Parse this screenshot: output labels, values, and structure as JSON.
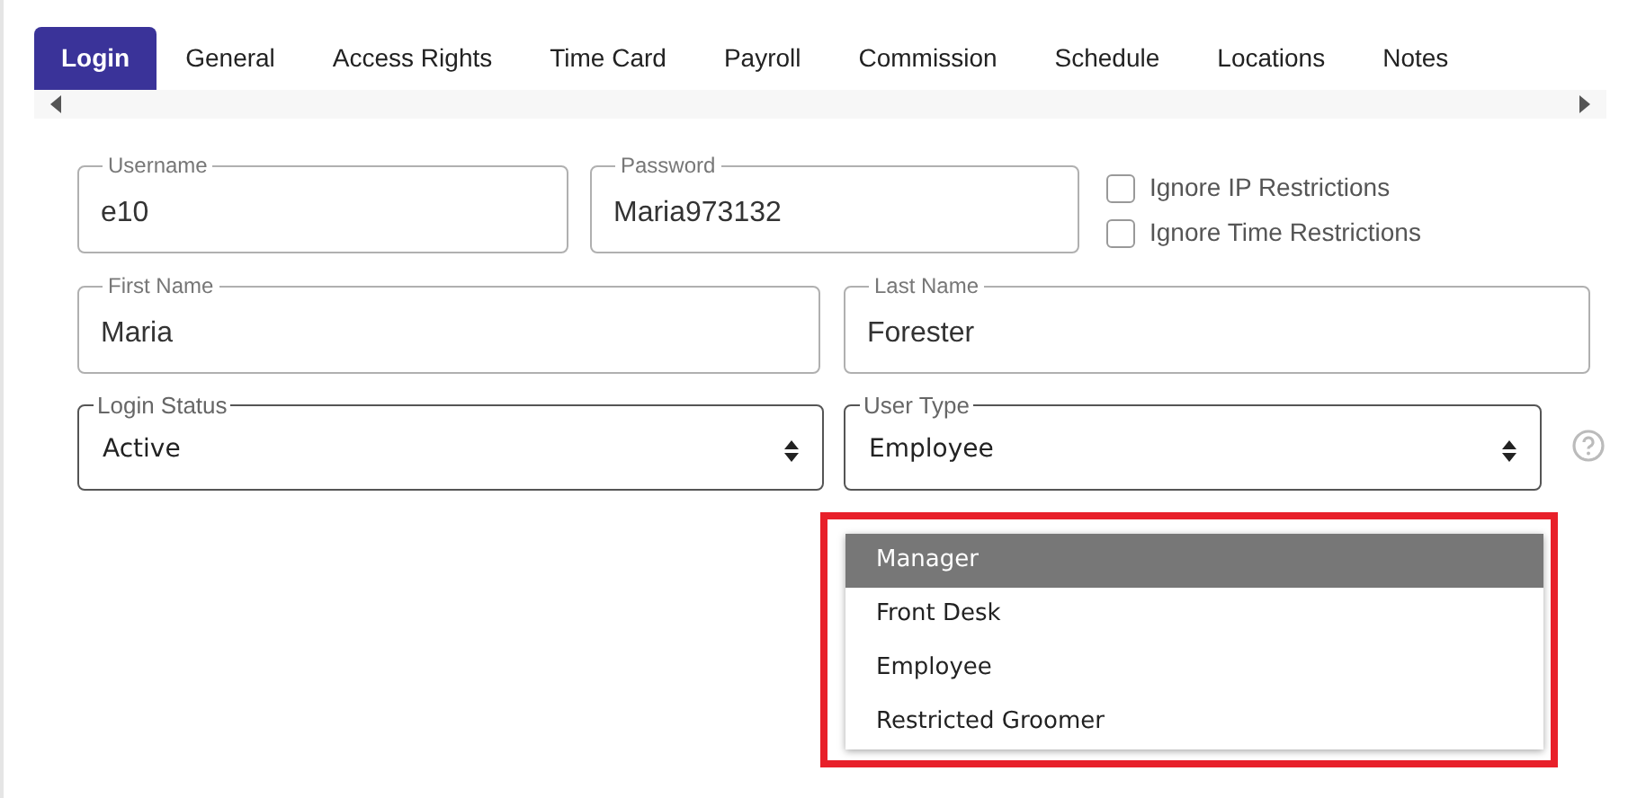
{
  "tabs": [
    {
      "label": "Login",
      "selected": true
    },
    {
      "label": "General",
      "selected": false
    },
    {
      "label": "Access Rights",
      "selected": false
    },
    {
      "label": "Time Card",
      "selected": false
    },
    {
      "label": "Payroll",
      "selected": false
    },
    {
      "label": "Commission",
      "selected": false
    },
    {
      "label": "Schedule",
      "selected": false
    },
    {
      "label": "Locations",
      "selected": false
    },
    {
      "label": "Notes",
      "selected": false
    }
  ],
  "username": {
    "label": "Username",
    "value": "e10"
  },
  "password": {
    "label": "Password",
    "value": "Maria973132"
  },
  "checkboxes": [
    {
      "label": "Ignore IP Restrictions",
      "checked": false
    },
    {
      "label": "Ignore Time Restrictions",
      "checked": false
    }
  ],
  "first_name": {
    "label": "First Name",
    "value": "Maria"
  },
  "last_name": {
    "label": "Last Name",
    "value": "Forester"
  },
  "login_status": {
    "label": "Login Status",
    "value": "Active"
  },
  "user_type": {
    "label": "User Type",
    "value": "Employee",
    "open": true,
    "options": [
      {
        "label": "Manager",
        "highlighted": true
      },
      {
        "label": "Front Desk",
        "highlighted": false
      },
      {
        "label": "Employee",
        "highlighted": false
      },
      {
        "label": "Restricted Groomer",
        "highlighted": false
      }
    ]
  }
}
